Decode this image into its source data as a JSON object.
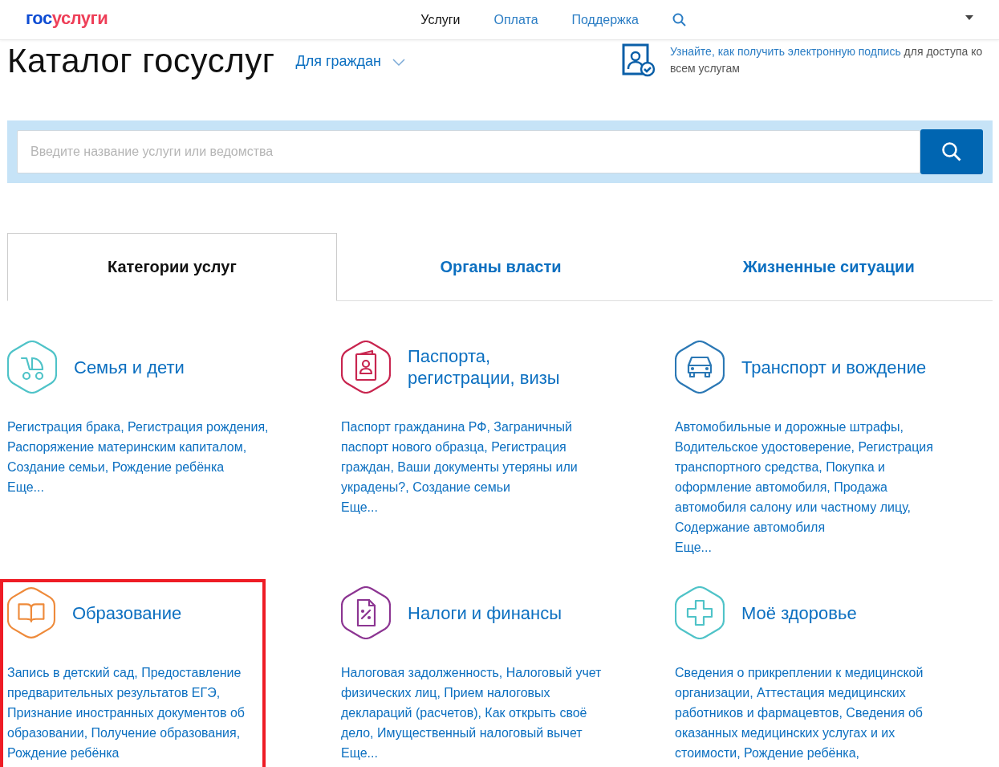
{
  "header": {
    "logo": {
      "first": "гос",
      "second": "услуги"
    },
    "nav": [
      {
        "label": "Услуги",
        "selected": true
      },
      {
        "label": "Оплата",
        "selected": false
      },
      {
        "label": "Поддержка",
        "selected": false
      }
    ]
  },
  "title": "Каталог госуслуг",
  "audience": "Для граждан",
  "signature_promo": {
    "link": "Узнайте, как получить электронную подпись",
    "rest": "для доступа ко всем услугам"
  },
  "search": {
    "placeholder": "Введите название услуги или ведомства"
  },
  "tabs": [
    {
      "label": "Категории услуг",
      "selected": true
    },
    {
      "label": "Органы власти",
      "selected": false
    },
    {
      "label": "Жизненные ситуации",
      "selected": false
    }
  ],
  "categories": [
    {
      "kind": "stroller",
      "color": "#4fc3c8",
      "title": "Семья и дети",
      "services": "Регистрация брака, Регистрация рождения, Распоряжение материнским капиталом, Создание семьи, Рождение ребёнка",
      "more": "Еще...",
      "highlighted": false
    },
    {
      "kind": "passport",
      "color": "#c8254f",
      "title": "Паспорта, регистрации, визы",
      "services": "Паспорт гражданина РФ, Заграничный паспорт нового образца, Регистрация граждан, Ваши документы утеряны или украдены?, Создание семьи",
      "more": "Еще...",
      "highlighted": false
    },
    {
      "kind": "car",
      "color": "#2b78b5",
      "title": "Транспорт и вождение",
      "services": "Автомобильные и дорожные штрафы, Водительское удостоверение, Регистрация транспортного средства, Покупка и оформление автомобиля, Продажа автомобиля салону или частному лицу, Содержание автомобиля",
      "more": "Еще...",
      "highlighted": false
    },
    {
      "kind": "book",
      "color": "#ee8a3a",
      "title": "Образование",
      "services": "Запись в детский сад, Предоставление предварительных результатов ЕГЭ, Признание иностранных документов об образовании, Получение образования, Рождение ребёнка",
      "highlighted": true
    },
    {
      "kind": "tax",
      "color": "#8c3592",
      "title": "Налоги и финансы",
      "services": "Налоговая задолженность, Налоговый учет физических лиц, Прием налоговых деклараций (расчетов), Как открыть своё дело, Имущественный налоговый вычет",
      "more": "Еще...",
      "highlighted": false
    },
    {
      "kind": "cross",
      "color": "#4fc3c8",
      "title": "Моё здоровье",
      "services": "Сведения о прикреплении к медицинской организации, Аттестация медицинских работников и фармацевтов, Сведения об оказанных медицинских услугах и их стоимости, Рождение ребёнка,",
      "highlighted": false
    }
  ]
}
